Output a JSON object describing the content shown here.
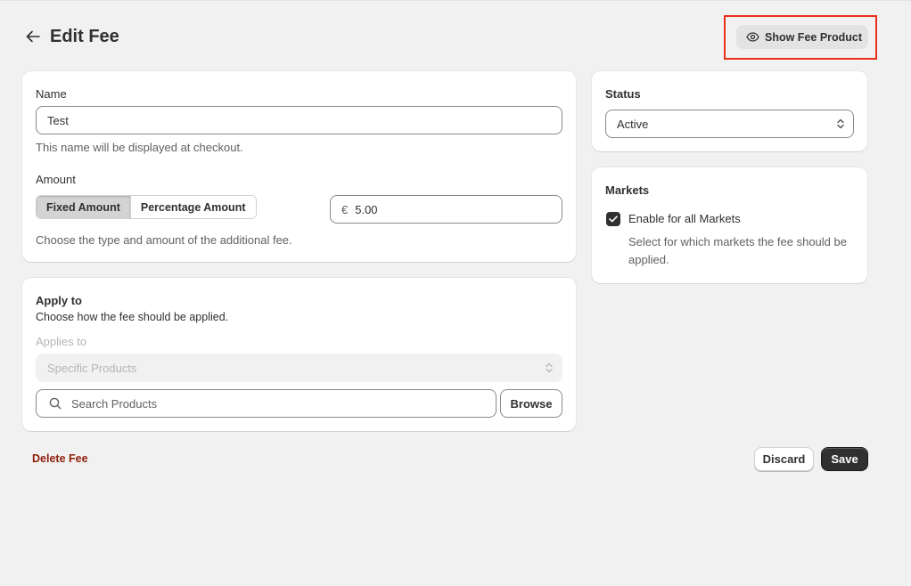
{
  "header": {
    "title": "Edit Fee",
    "show_fee_product_label": "Show Fee Product"
  },
  "fee": {
    "name_label": "Name",
    "name_value": "Test",
    "name_help": "This name will be displayed at checkout.",
    "amount_label": "Amount",
    "fixed_amount_label": "Fixed Amount",
    "percentage_amount_label": "Percentage Amount",
    "selected_type": "Fixed Amount",
    "currency_symbol": "€",
    "amount_value": "5.00",
    "amount_help": "Choose the type and amount of the additional fee."
  },
  "apply_to": {
    "title": "Apply to",
    "description": "Choose how the fee should be applied.",
    "applies_to_label": "Applies to",
    "applies_to_value": "Specific Products",
    "search_placeholder": "Search Products",
    "browse_label": "Browse"
  },
  "status": {
    "title": "Status",
    "value": "Active"
  },
  "markets": {
    "title": "Markets",
    "checkbox_label": "Enable for all Markets",
    "checked": true,
    "help": "Select for which markets the fee should be applied."
  },
  "footer": {
    "delete_label": "Delete Fee",
    "discard_label": "Discard",
    "save_label": "Save"
  },
  "colors": {
    "highlight": "#e8301c",
    "danger": "#8e1f0b",
    "primary": "#303030"
  }
}
